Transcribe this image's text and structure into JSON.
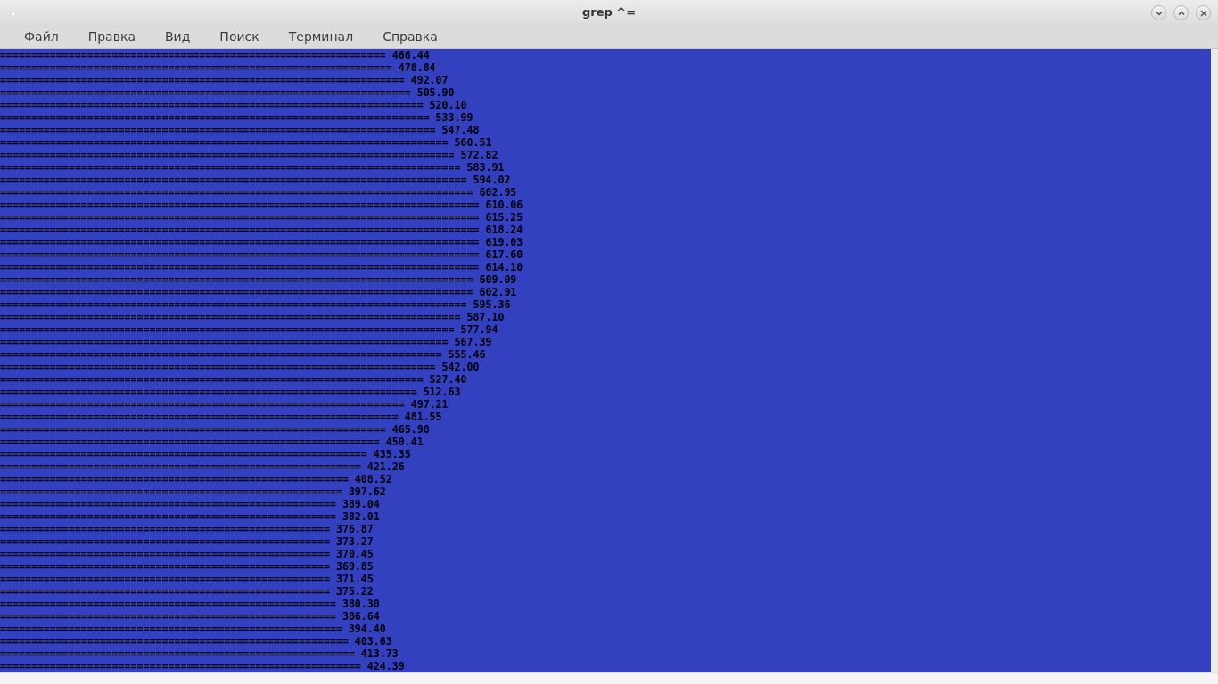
{
  "window": {
    "title": "grep ^="
  },
  "menu": [
    "Файл",
    "Правка",
    "Вид",
    "Поиск",
    "Терминал",
    "Справка"
  ],
  "terminal_lines": [
    "============================================================== 466.44",
    "=============================================================== 478.84",
    "================================================================= 492.07",
    "================================================================== 505.90",
    "==================================================================== 520.10",
    "===================================================================== 533.99",
    "====================================================================== 547.48",
    "======================================================================== 560.51",
    "========================================================================= 572.82",
    "========================================================================== 583.91",
    "=========================================================================== 594.02",
    "============================================================================ 602.95",
    "============================================================================= 610.06",
    "============================================================================= 615.25",
    "============================================================================= 618.24",
    "============================================================================= 619.03",
    "============================================================================= 617.60",
    "============================================================================= 614.10",
    "============================================================================ 609.09",
    "============================================================================ 602.91",
    "=========================================================================== 595.36",
    "========================================================================== 587.10",
    "========================================================================= 577.94",
    "======================================================================== 567.39",
    "======================================================================= 555.46",
    "====================================================================== 542.00",
    "==================================================================== 527.40",
    "=================================================================== 512.63",
    "================================================================= 497.21",
    "================================================================ 481.55",
    "============================================================== 465.98",
    "============================================================= 450.41",
    "=========================================================== 435.35",
    "========================================================== 421.26",
    "======================================================== 408.52",
    "======================================================= 397.62",
    "====================================================== 389.04",
    "====================================================== 382.01",
    "===================================================== 376.87",
    "===================================================== 373.27",
    "===================================================== 370.45",
    "===================================================== 369.85",
    "===================================================== 371.45",
    "===================================================== 375.22",
    "====================================================== 380.30",
    "====================================================== 386.64",
    "======================================================= 394.40",
    "======================================================== 403.63",
    "========================================================= 413.73",
    "========================================================== 424.39"
  ]
}
